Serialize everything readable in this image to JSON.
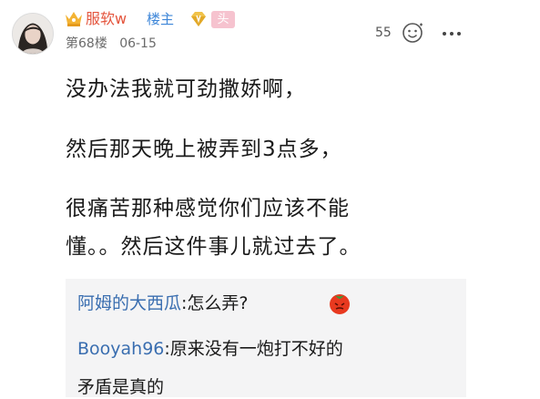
{
  "post": {
    "author": {
      "name": "服软w",
      "op_label": "楼主",
      "level_badge": "头"
    },
    "floor": "第68楼",
    "date": "06-15",
    "likes": "55",
    "body_lines": [
      "没办法我就可劲撒娇啊，",
      "然后那天晚上被弄到3点多，",
      "很痛苦那种感觉你们应该不能",
      "懂。。然后这件事儿就过去了。"
    ],
    "colors": {
      "username": "#e4543c",
      "op_label": "#3d86d8",
      "level_badge_bg": "#f6c3cf",
      "reply_name": "#3a6eb0",
      "reply_bg": "#f4f4f5"
    }
  },
  "replies": [
    {
      "name": "阿姆的大西瓜",
      "separator": ":",
      "text": "怎么弄?",
      "icon": "tomato-emoji-icon"
    },
    {
      "name": "Booyah96",
      "separator": ":",
      "text": "原来没有一炮打不好的"
    },
    {
      "continuation": "矛盾是真的"
    }
  ],
  "icons": [
    "avatar",
    "crown-icon",
    "diamond-icon",
    "like-icon",
    "more-icon",
    "tomato-emoji-icon"
  ]
}
